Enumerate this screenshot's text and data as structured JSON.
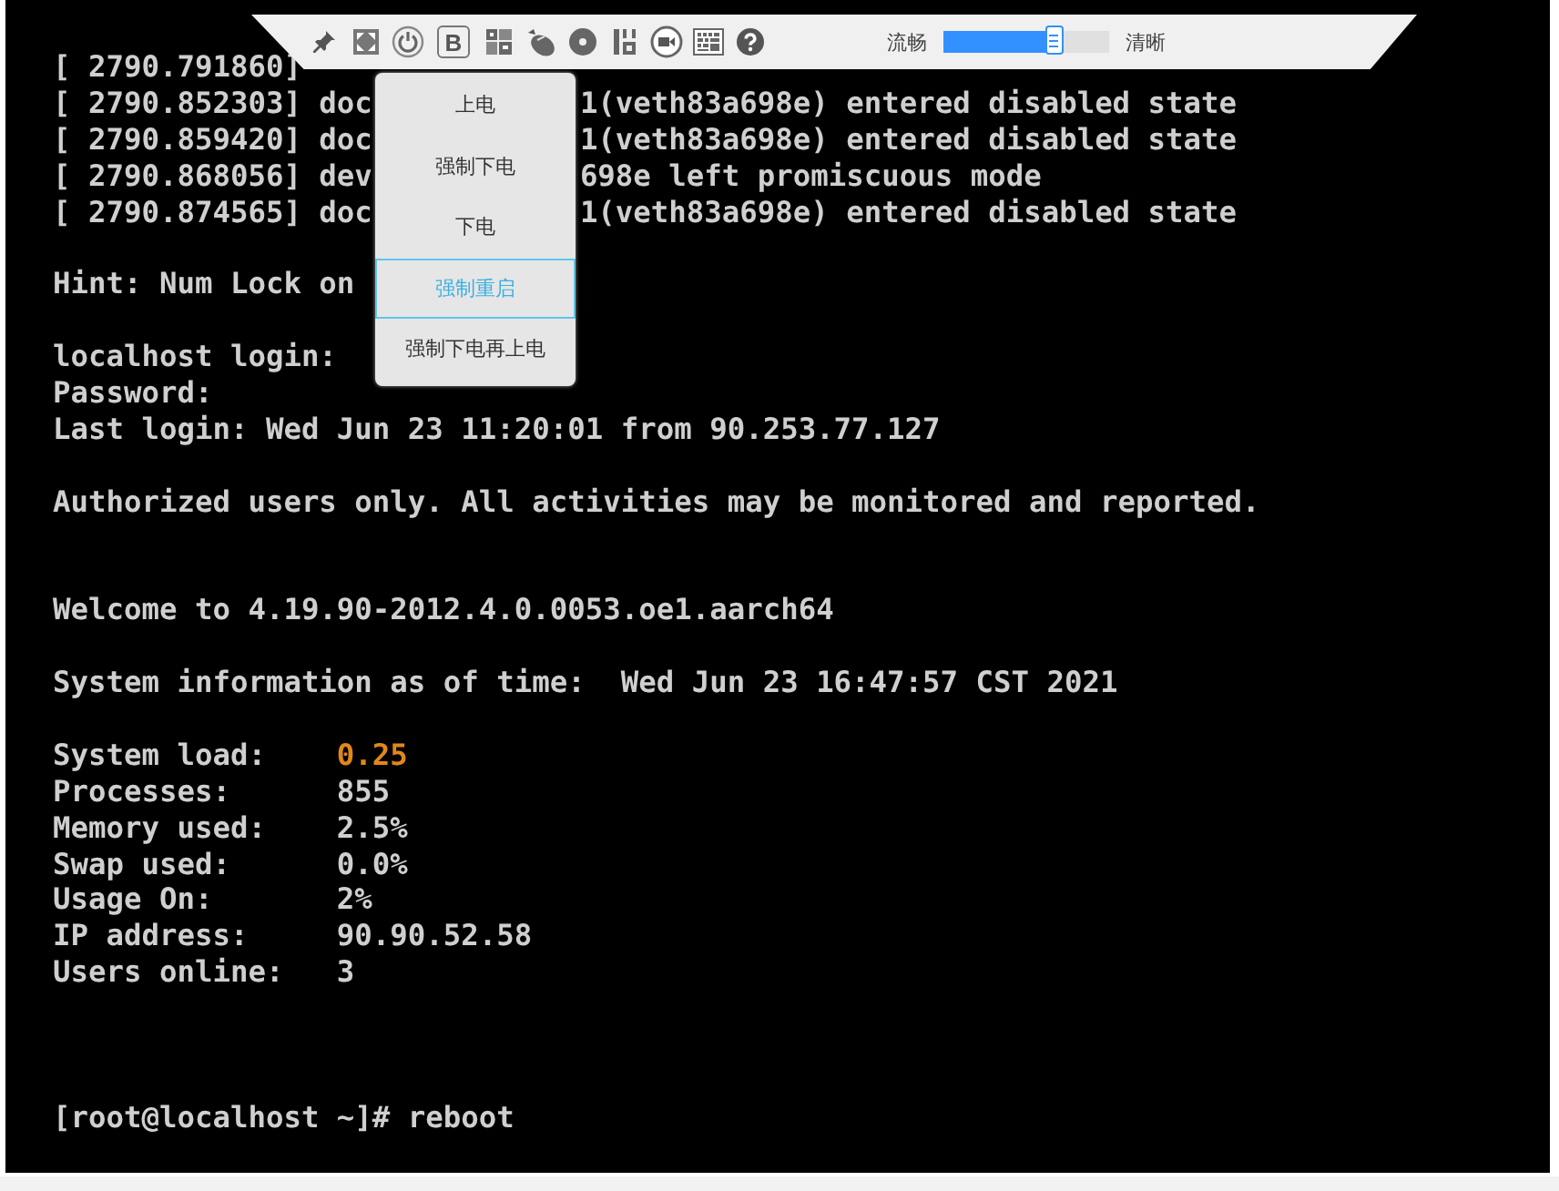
{
  "toolbar": {
    "buttons": [
      {
        "kind": "pin"
      },
      {
        "kind": "fullscreen"
      },
      {
        "kind": "power"
      },
      {
        "kind": "letter",
        "label": "B"
      },
      {
        "kind": "keys"
      },
      {
        "kind": "mouse"
      },
      {
        "kind": "disc"
      },
      {
        "kind": "save"
      },
      {
        "kind": "record"
      },
      {
        "kind": "keyboard"
      },
      {
        "kind": "help"
      }
    ],
    "quality": {
      "low_label": "流畅",
      "high_label": "清晰",
      "level": 0.67
    }
  },
  "power_menu": {
    "items": [
      {
        "label": "上电",
        "selected": false
      },
      {
        "label": "强制下电",
        "selected": false
      },
      {
        "label": "下电",
        "selected": false
      },
      {
        "label": "强制重启",
        "selected": true
      },
      {
        "label": "强制下电再上电",
        "selected": false
      }
    ]
  },
  "console": {
    "lines": [
      {
        "kind": "text",
        "text": "[ 2790.791860]"
      },
      {
        "kind": "split",
        "segments": [
          "[ 2790.852303] doc",
          "1(veth83a698e) entered disabled state"
        ]
      },
      {
        "kind": "split",
        "segments": [
          "[ 2790.859420] doc",
          "1(veth83a698e) entered disabled state"
        ]
      },
      {
        "kind": "split",
        "segments": [
          "[ 2790.868056] dev",
          "698e left promiscuous mode"
        ]
      },
      {
        "kind": "split",
        "segments": [
          "[ 2790.874565] doc",
          "1(veth83a698e) entered disabled state"
        ]
      },
      {
        "kind": "blank"
      },
      {
        "kind": "text",
        "text": "Hint: Num Lock on"
      },
      {
        "kind": "blank"
      },
      {
        "kind": "text",
        "text": "localhost login:"
      },
      {
        "kind": "text",
        "text": "Password:"
      },
      {
        "kind": "text",
        "text": "Last login: Wed Jun 23 11:20:01 from 90.253.77.127"
      },
      {
        "kind": "blank"
      },
      {
        "kind": "text",
        "text": "Authorized users only. All activities may be monitored and reported."
      },
      {
        "kind": "blank"
      },
      {
        "kind": "blank"
      },
      {
        "kind": "text",
        "text": "Welcome to 4.19.90-2012.4.0.0053.oe1.aarch64"
      },
      {
        "kind": "blank"
      },
      {
        "kind": "text",
        "text": "System information as of time:  Wed Jun 23 16:47:57 CST 2021"
      },
      {
        "kind": "blank"
      },
      {
        "kind": "info",
        "label": "System load:",
        "value": "0.25",
        "warning": true
      },
      {
        "kind": "info",
        "label": "Processes:",
        "value": "855",
        "warning": false
      },
      {
        "kind": "info",
        "label": "Memory used:",
        "value": "2.5%",
        "warning": false
      },
      {
        "kind": "info",
        "label": "Swap used:",
        "value": "0.0%",
        "warning": false
      },
      {
        "kind": "info",
        "label": "Usage On:",
        "value": "2%",
        "warning": false
      },
      {
        "kind": "info",
        "label": "IP address:",
        "value": "90.90.52.58",
        "warning": false
      },
      {
        "kind": "info",
        "label": "Users online:",
        "value": "3",
        "warning": false
      },
      {
        "kind": "blank"
      },
      {
        "kind": "blank"
      },
      {
        "kind": "blank"
      },
      {
        "kind": "text",
        "text": "[root@localhost ~]# reboot"
      }
    ]
  }
}
